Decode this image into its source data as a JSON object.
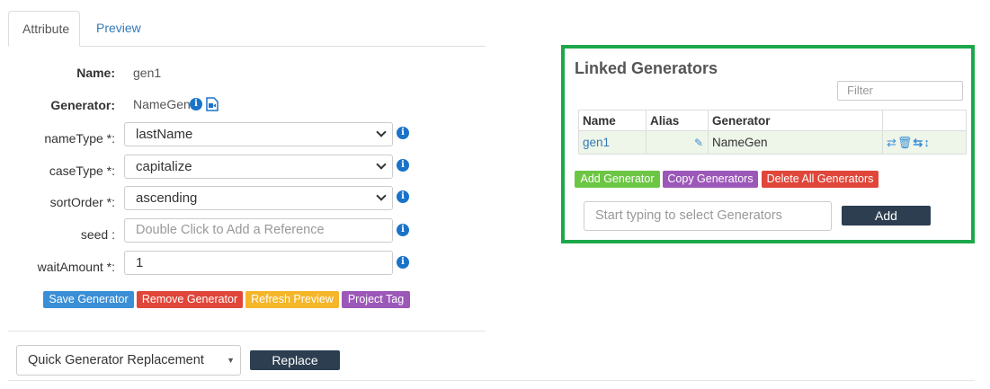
{
  "tabs": {
    "attribute": "Attribute",
    "preview": "Preview"
  },
  "form": {
    "name_label": "Name:",
    "name_value": "gen1",
    "generator_label": "Generator:",
    "generator_value": "NameGen",
    "fields": [
      {
        "label": "nameType *:",
        "value": "lastName",
        "kind": "select"
      },
      {
        "label": "caseType *:",
        "value": "capitalize",
        "kind": "select"
      },
      {
        "label": "sortOrder *:",
        "value": "ascending",
        "kind": "select"
      },
      {
        "label": "seed :",
        "placeholder": "Double Click to Add a Reference",
        "kind": "input"
      },
      {
        "label": "waitAmount *:",
        "value": "1",
        "kind": "input"
      }
    ]
  },
  "buttons": {
    "save": "Save Generator",
    "remove": "Remove Generator",
    "refresh": "Refresh Preview",
    "project_tag": "Project Tag"
  },
  "quick_replace": {
    "select_value": "Quick Generator Replacement",
    "replace_label": "Replace"
  },
  "linked": {
    "title": "Linked Generators",
    "filter_placeholder": "Filter",
    "columns": [
      "Name",
      "Alias",
      "Generator",
      ""
    ],
    "rows": [
      {
        "name": "gen1",
        "alias": "",
        "generator": "NameGen"
      }
    ],
    "add_generator": "Add Generator",
    "copy_generators": "Copy Generators",
    "delete_all": "Delete All Generators",
    "select_placeholder": "Start typing to select Generators",
    "add_label": "Add"
  },
  "icons": [
    "info-icon",
    "video-icon",
    "pencil-icon",
    "swap-icon",
    "trash-icon",
    "exchange-icon",
    "sort-icon",
    "chevron-down-icon"
  ],
  "colors": {
    "panel_border": "#1ca84a",
    "link": "#337ab7",
    "btn_blue": "#3a8fd6",
    "btn_red": "#e0463a",
    "btn_yellow": "#f5b62a",
    "btn_purple": "#9c58b8",
    "btn_green": "#6cc644",
    "btn_dark": "#2c3e50"
  }
}
